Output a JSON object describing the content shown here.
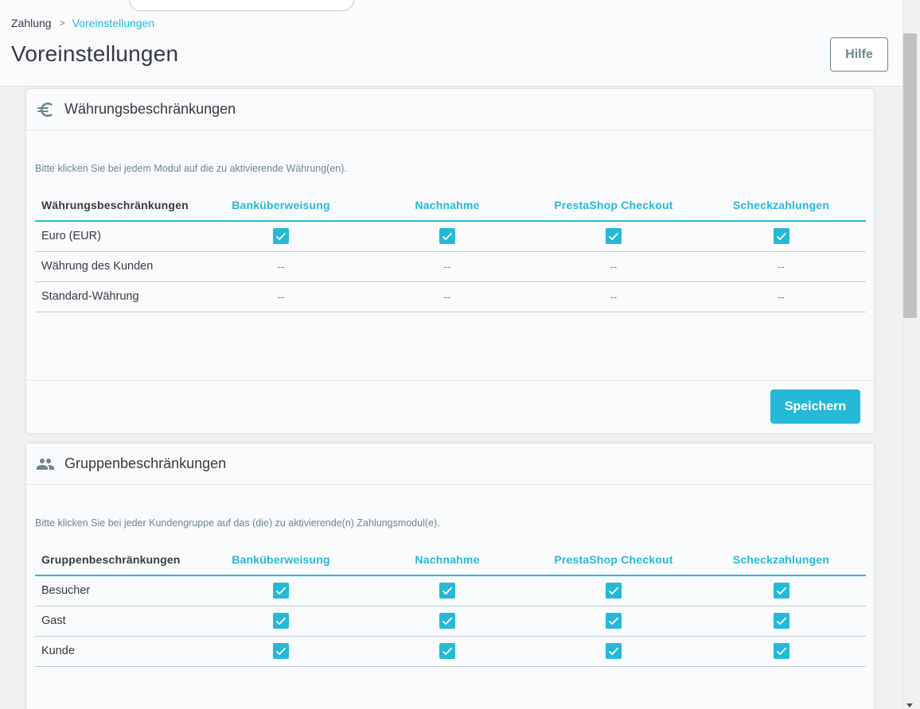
{
  "breadcrumb": {
    "parent": "Zahlung",
    "separator": ">",
    "current": "Voreinstellungen"
  },
  "page": {
    "title": "Voreinstellungen",
    "help_label": "Hilfe"
  },
  "currency_card": {
    "title": "Währungsbeschränkungen",
    "icon": "euro-icon",
    "description": "Bitte klicken Sie bei jedem Modul auf die zu aktivierende Währung(en).",
    "columns": [
      "Währungsbeschränkungen",
      "Banküberweisung",
      "Nachnahme",
      "PrestaShop Checkout",
      "Scheckzahlungen"
    ],
    "rows": [
      {
        "label": "Euro (EUR)",
        "cells": [
          true,
          true,
          true,
          true
        ]
      },
      {
        "label": "Währung des Kunden",
        "cells": [
          "--",
          "--",
          "--",
          "--"
        ]
      },
      {
        "label": "Standard-Währung",
        "cells": [
          "--",
          "--",
          "--",
          "--"
        ]
      }
    ],
    "save_label": "Speichern"
  },
  "group_card": {
    "title": "Gruppenbeschränkungen",
    "icon": "people-icon",
    "description": "Bitte klicken Sie bei jeder Kundengruppe auf das (die) zu aktivierende(n) Zahlungsmodul(e).",
    "columns": [
      "Gruppenbeschränkungen",
      "Banküberweisung",
      "Nachnahme",
      "PrestaShop Checkout",
      "Scheckzahlungen"
    ],
    "rows": [
      {
        "label": "Besucher",
        "cells": [
          true,
          true,
          true,
          true
        ]
      },
      {
        "label": "Gast",
        "cells": [
          true,
          true,
          true,
          true
        ]
      },
      {
        "label": "Kunde",
        "cells": [
          true,
          true,
          true,
          true
        ]
      }
    ]
  },
  "colors": {
    "accent": "#25b9d7",
    "text": "#363a41",
    "muted": "#6c868e"
  }
}
